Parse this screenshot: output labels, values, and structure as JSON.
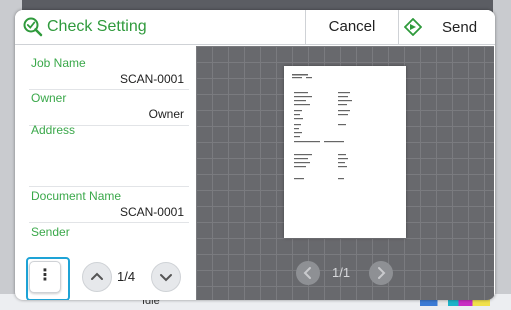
{
  "title": "Check Setting",
  "buttons": {
    "cancel": "Cancel",
    "send": "Send"
  },
  "fields": [
    {
      "label": "Job Name",
      "value": "SCAN-0001"
    },
    {
      "label": "Owner",
      "value": "Owner"
    },
    {
      "label": "Address",
      "value": ""
    },
    {
      "label": "Document Name",
      "value": "SCAN-0001"
    },
    {
      "label": "Sender",
      "value": ""
    }
  ],
  "pager": {
    "info_page": "1/4",
    "preview_page": "1/1"
  },
  "background": {
    "status": "Idle"
  },
  "colors": {
    "accent": "#2f9a3c",
    "highlight": "#1ea3d6"
  }
}
